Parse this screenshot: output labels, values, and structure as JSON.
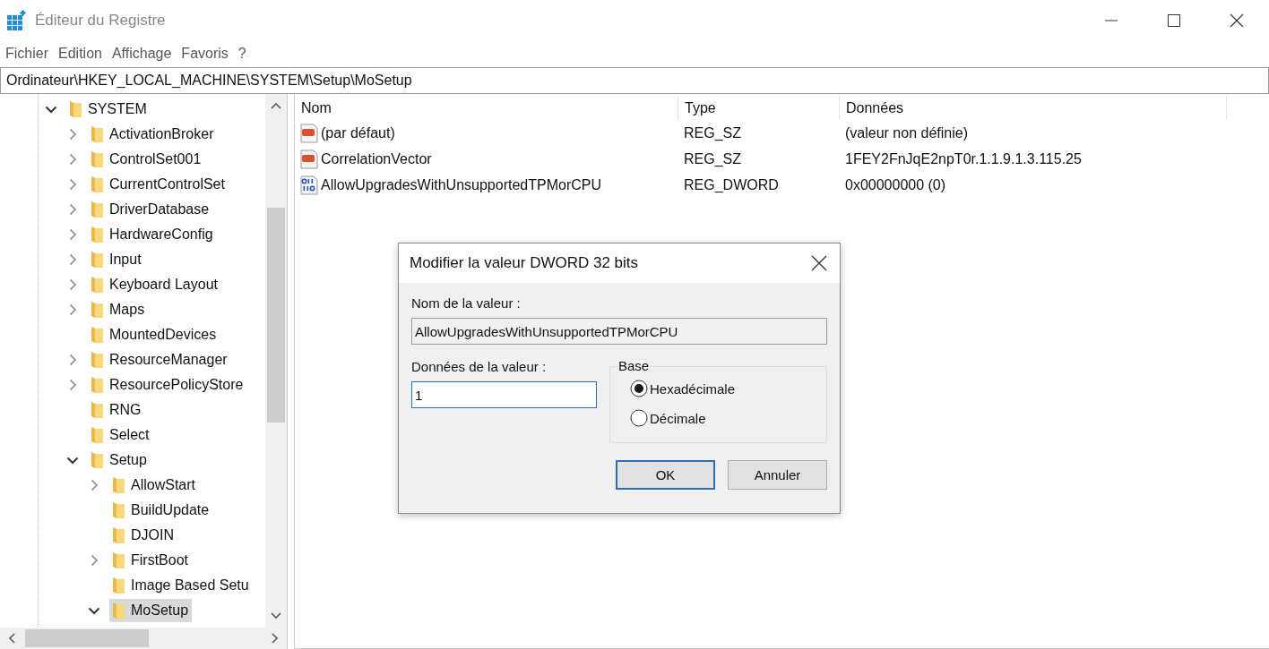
{
  "window": {
    "title": "Éditeur du Registre"
  },
  "menu": [
    "Fichier",
    "Edition",
    "Affichage",
    "Favoris",
    "?"
  ],
  "address": "Ordinateur\\HKEY_LOCAL_MACHINE\\SYSTEM\\Setup\\MoSetup",
  "tree": [
    {
      "label": "SYSTEM",
      "kind": "branch",
      "expanded": true,
      "selected": false,
      "children": [
        {
          "label": "ActivationBroker",
          "kind": "branch",
          "expanded": false,
          "selected": false
        },
        {
          "label": "ControlSet001",
          "kind": "branch",
          "expanded": false,
          "selected": false
        },
        {
          "label": "CurrentControlSet",
          "kind": "branch",
          "expanded": false,
          "selected": false
        },
        {
          "label": "DriverDatabase",
          "kind": "branch",
          "expanded": false,
          "selected": false
        },
        {
          "label": "HardwareConfig",
          "kind": "branch",
          "expanded": false,
          "selected": false
        },
        {
          "label": "Input",
          "kind": "branch",
          "expanded": false,
          "selected": false
        },
        {
          "label": "Keyboard Layout",
          "kind": "branch",
          "expanded": false,
          "selected": false
        },
        {
          "label": "Maps",
          "kind": "branch",
          "expanded": false,
          "selected": false
        },
        {
          "label": "MountedDevices",
          "kind": "leaf",
          "selected": false
        },
        {
          "label": "ResourceManager",
          "kind": "branch",
          "expanded": false,
          "selected": false
        },
        {
          "label": "ResourcePolicyStore",
          "kind": "branch",
          "expanded": false,
          "selected": false
        },
        {
          "label": "RNG",
          "kind": "leaf",
          "selected": false
        },
        {
          "label": "Select",
          "kind": "leaf",
          "selected": false
        },
        {
          "label": "Setup",
          "kind": "branch",
          "expanded": true,
          "selected": false,
          "children": [
            {
              "label": "AllowStart",
              "kind": "branch",
              "expanded": false,
              "selected": false
            },
            {
              "label": "BuildUpdate",
              "kind": "leaf",
              "selected": false
            },
            {
              "label": "DJOIN",
              "kind": "leaf",
              "selected": false
            },
            {
              "label": "FirstBoot",
              "kind": "branch",
              "expanded": false,
              "selected": false
            },
            {
              "label": "Image Based Setu",
              "kind": "leaf",
              "selected": false
            },
            {
              "label": "MoSetup",
              "kind": "branch",
              "expanded": true,
              "selected": true
            }
          ]
        }
      ]
    }
  ],
  "table": {
    "columns": [
      "Nom",
      "Type",
      "Données"
    ],
    "rows": [
      {
        "kind": "string",
        "name": "(par défaut)",
        "type": "REG_SZ",
        "data": "(valeur non définie)"
      },
      {
        "kind": "string",
        "name": "CorrelationVector",
        "type": "REG_SZ",
        "data": "1FEY2FnJqE2npT0r.1.1.9.1.3.115.25"
      },
      {
        "kind": "binary",
        "name": "AllowUpgradesWithUnsupportedTPMorCPU",
        "type": "REG_DWORD",
        "data": "0x00000000 (0)"
      }
    ]
  },
  "dialog": {
    "title": "Modifier la valeur DWORD 32 bits",
    "name_label": "Nom de la valeur :",
    "name_value": "AllowUpgradesWithUnsupportedTPMorCPU",
    "data_label": "Données de la valeur :",
    "data_value": "1",
    "base_label": "Base",
    "bases": [
      {
        "label": "Hexadécimale",
        "selected": true
      },
      {
        "label": "Décimale",
        "selected": false
      }
    ],
    "buttons": [
      {
        "label": "OK",
        "default": true
      },
      {
        "label": "Annuler",
        "default": false
      }
    ]
  }
}
